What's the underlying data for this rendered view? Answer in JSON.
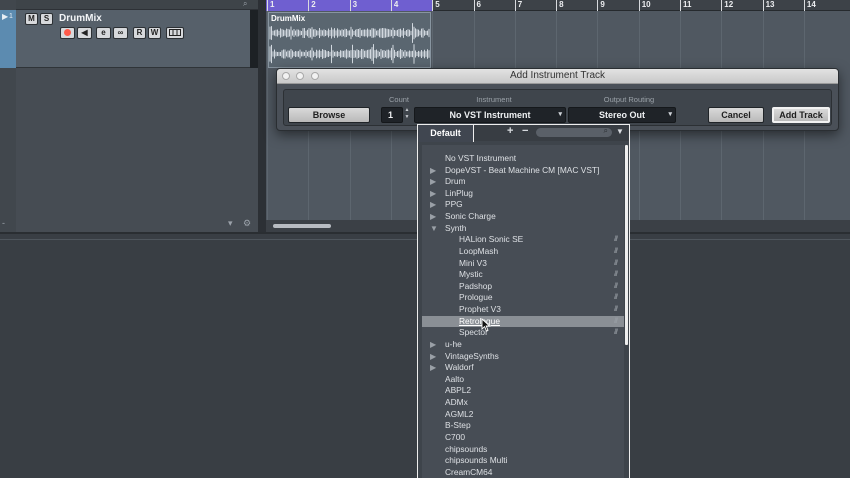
{
  "project": {
    "track": {
      "name": "DrumMix",
      "number": "1",
      "buttons": {
        "mute": "M",
        "solo": "S",
        "read": "R",
        "write": "W",
        "monitor": "◀",
        "edit": "e",
        "link": "∞"
      }
    },
    "clip": {
      "name": "DrumMix"
    },
    "ruler": {
      "bars": [
        "1",
        "2",
        "3",
        "4",
        "5",
        "6",
        "7",
        "8",
        "9",
        "10",
        "11",
        "12",
        "13",
        "14"
      ]
    }
  },
  "dialog": {
    "title": "Add Instrument Track",
    "columns": {
      "count": "Count",
      "instrument": "Instrument",
      "output": "Output Routing"
    },
    "browse_label": "Browse",
    "count_value": "1",
    "instrument_value": "No VST Instrument",
    "output_value": "Stereo Out",
    "cancel_label": "Cancel",
    "add_label": "Add Track"
  },
  "popup": {
    "tab": "Default",
    "plus": "+",
    "minus": "−",
    "items": [
      {
        "label": "No VST Instrument",
        "level": 0,
        "folder": false
      },
      {
        "label": "DopeVST - Beat Machine CM [MAC VST]",
        "level": 0,
        "folder": true,
        "open": false
      },
      {
        "label": "Drum",
        "level": 0,
        "folder": true,
        "open": false
      },
      {
        "label": "LinPlug",
        "level": 0,
        "folder": true,
        "open": false
      },
      {
        "label": "PPG",
        "level": 0,
        "folder": true,
        "open": false
      },
      {
        "label": "Sonic Charge",
        "level": 0,
        "folder": true,
        "open": false
      },
      {
        "label": "Synth",
        "level": 0,
        "folder": true,
        "open": true
      },
      {
        "label": "HALion Sonic SE",
        "level": 1,
        "folder": false,
        "badge": "///"
      },
      {
        "label": "LoopMash",
        "level": 1,
        "folder": false,
        "badge": "///"
      },
      {
        "label": "Mini V3",
        "level": 1,
        "folder": false,
        "badge": "///"
      },
      {
        "label": "Mystic",
        "level": 1,
        "folder": false,
        "badge": "///"
      },
      {
        "label": "Padshop",
        "level": 1,
        "folder": false,
        "badge": "///"
      },
      {
        "label": "Prologue",
        "level": 1,
        "folder": false,
        "badge": "///"
      },
      {
        "label": "Prophet V3",
        "level": 1,
        "folder": false,
        "badge": "///"
      },
      {
        "label": "Retrologue",
        "level": 1,
        "folder": false,
        "badge": "///",
        "selected": true
      },
      {
        "label": "Spector",
        "level": 1,
        "folder": false,
        "badge": "///"
      },
      {
        "label": "u-he",
        "level": 0,
        "folder": true,
        "open": false
      },
      {
        "label": "VintageSynths",
        "level": 0,
        "folder": true,
        "open": false
      },
      {
        "label": "Waldorf",
        "level": 0,
        "folder": true,
        "open": false
      },
      {
        "label": "Aalto",
        "level": 0,
        "folder": false
      },
      {
        "label": "ABPL2",
        "level": 0,
        "folder": false
      },
      {
        "label": "ADMx",
        "level": 0,
        "folder": false
      },
      {
        "label": "AGML2",
        "level": 0,
        "folder": false
      },
      {
        "label": "B-Step",
        "level": 0,
        "folder": false
      },
      {
        "label": "C700",
        "level": 0,
        "folder": false
      },
      {
        "label": "chipsounds",
        "level": 0,
        "folder": false
      },
      {
        "label": "chipsounds Multi",
        "level": 0,
        "folder": false
      },
      {
        "label": "CreamCM64",
        "level": 0,
        "folder": false
      }
    ]
  },
  "colors": {
    "accent_loop": "#6f5fd0",
    "record": "#ff5a4a",
    "selection": "#5c8bb0"
  }
}
